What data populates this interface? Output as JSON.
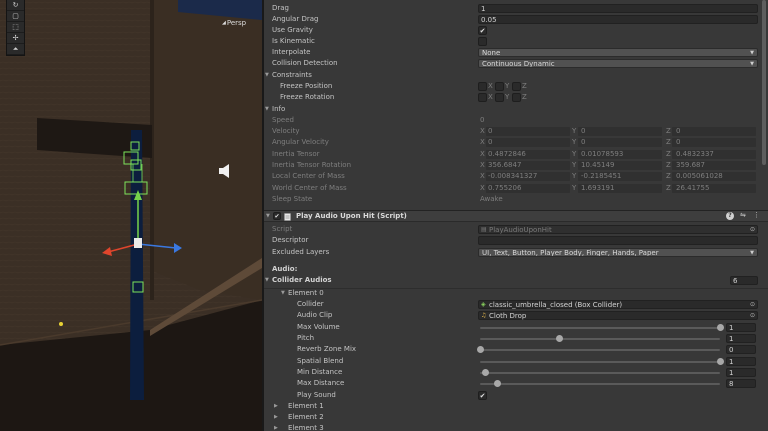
{
  "scene": {
    "tools": [
      "orbit-tool",
      "rect-tool",
      "transform-tool",
      "custom-tool",
      "gizmo-toggle"
    ],
    "tool_glyphs": [
      "↻",
      "▢",
      "⬚",
      "✢",
      "⏶"
    ],
    "persp_label": "Persp",
    "sound_icon": "speaker-icon"
  },
  "rigidbody": {
    "drag": {
      "label": "Drag",
      "value": "1"
    },
    "angular_drag": {
      "label": "Angular Drag",
      "value": "0.05"
    },
    "use_gravity": {
      "label": "Use Gravity",
      "checked": true
    },
    "is_kinematic": {
      "label": "Is Kinematic",
      "checked": false
    },
    "interpolate": {
      "label": "Interpolate",
      "value": "None"
    },
    "collision": {
      "label": "Collision Detection",
      "value": "Continuous Dynamic"
    },
    "constraints": {
      "label": "Constraints",
      "freeze_position": "Freeze Position",
      "freeze_rotation": "Freeze Rotation",
      "axes": [
        "X",
        "Y",
        "Z"
      ]
    },
    "info": {
      "label": "Info",
      "speed": {
        "label": "Speed",
        "value": "0"
      },
      "velocity": {
        "label": "Velocity",
        "x": "0",
        "y": "0",
        "z": "0"
      },
      "angular_velocity": {
        "label": "Angular Velocity",
        "x": "0",
        "y": "0",
        "z": "0"
      },
      "inertia_tensor": {
        "label": "Inertia Tensor",
        "x": "0.4872846",
        "y": "0.01078593",
        "z": "0.4832337"
      },
      "inertia_tensor_rotation": {
        "label": "Inertia Tensor Rotation",
        "x": "356.6847",
        "y": "10.45149",
        "z": "359.687"
      },
      "local_center": {
        "label": "Local Center of Mass",
        "x": "-0.008341327",
        "y": "-0.2185451",
        "z": "0.005061028"
      },
      "world_center": {
        "label": "World Center of Mass",
        "x": "0.755206",
        "y": "1.693191",
        "z": "26.41755"
      },
      "sleep_state": {
        "label": "Sleep State",
        "value": "Awake"
      }
    }
  },
  "script_component": {
    "title": "Play Audio Upon Hit (Script)",
    "help_icon": "?",
    "settings_icon": "⇋",
    "menu_icon": "⋮",
    "script": {
      "label": "Script",
      "value": "PlayAudioUponHit"
    },
    "descriptor": {
      "label": "Descriptor",
      "value": ""
    },
    "excluded_layers": {
      "label": "Excluded Layers",
      "value": "UI, Text, Button, Player Body, Finger, Hands, Paper"
    },
    "audio_header": "Audio:",
    "collider_audios": {
      "label": "Collider Audios",
      "count": "6"
    },
    "element0": {
      "label": "Element 0",
      "collider": {
        "label": "Collider",
        "value": "classic_umbrella_closed (Box Collider)"
      },
      "audio_clip": {
        "label": "Audio Clip",
        "value": "Cloth Drop"
      },
      "max_volume": {
        "label": "Max Volume",
        "value": "1",
        "fraction": 1.0
      },
      "pitch": {
        "label": "Pitch",
        "value": "1",
        "fraction": 0.33
      },
      "reverb": {
        "label": "Reverb Zone Mix",
        "value": "0",
        "fraction": 0.0
      },
      "spatial_blend": {
        "label": "Spatial Blend",
        "value": "1",
        "fraction": 1.0
      },
      "min_distance": {
        "label": "Min Distance",
        "value": "1",
        "fraction": 0.02
      },
      "max_distance": {
        "label": "Max Distance",
        "value": "8",
        "fraction": 0.07
      },
      "play_sound": {
        "label": "Play Sound",
        "checked": true
      }
    },
    "elements": [
      "Element 1",
      "Element 2",
      "Element 3"
    ]
  },
  "icons": {
    "fold_open": "▼",
    "fold_closed": "▶",
    "check": "✔",
    "caret": "▼",
    "picker": "⊙"
  }
}
